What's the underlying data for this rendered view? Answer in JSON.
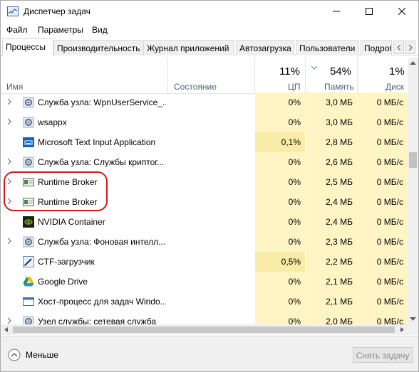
{
  "window": {
    "title": "Диспетчер задач"
  },
  "menu": [
    "Файл",
    "Параметры",
    "Вид"
  ],
  "tabs": [
    "Процессы",
    "Производительность",
    "Журнал приложений",
    "Автозагрузка",
    "Пользователи",
    "Подроб"
  ],
  "header": {
    "name": "Имя",
    "status": "Состояние",
    "cpu_pct": "11%",
    "cpu_label": "ЦП",
    "mem_pct": "54%",
    "mem_label": "Память",
    "disk_pct": "1%",
    "disk_label": "Диск"
  },
  "processes": [
    {
      "name": "Служба узла: WpnUserService_...",
      "cpu": "0%",
      "mem": "3,0 МБ",
      "disk": "0 МБ/с",
      "icon": "gear-icon",
      "expandable": true
    },
    {
      "name": "wsappx",
      "cpu": "0%",
      "mem": "3,0 МБ",
      "disk": "0 МБ/с",
      "icon": "gear-icon",
      "expandable": true
    },
    {
      "name": "Microsoft Text Input Application",
      "cpu": "0,1%",
      "mem": "2,8 МБ",
      "disk": "0 МБ/с",
      "icon": "keyboard-icon",
      "expandable": false
    },
    {
      "name": "Служба узла: Службы криптог...",
      "cpu": "0%",
      "mem": "2,6 МБ",
      "disk": "0 МБ/с",
      "icon": "gear-icon",
      "expandable": true
    },
    {
      "name": "Runtime Broker",
      "cpu": "0%",
      "mem": "2,5 МБ",
      "disk": "0 МБ/с",
      "icon": "window-icon",
      "expandable": true
    },
    {
      "name": "Runtime Broker",
      "cpu": "0%",
      "mem": "2,4 МБ",
      "disk": "0 МБ/с",
      "icon": "window-icon",
      "expandable": true
    },
    {
      "name": "NVIDIA Container",
      "cpu": "0%",
      "mem": "2,4 МБ",
      "disk": "0 МБ/с",
      "icon": "nvidia-icon",
      "expandable": false
    },
    {
      "name": "Служба узла: Фоновая интелл...",
      "cpu": "0%",
      "mem": "2,3 МБ",
      "disk": "0 МБ/с",
      "icon": "gear-icon",
      "expandable": true
    },
    {
      "name": "CTF-загрузчик",
      "cpu": "0,5%",
      "mem": "2,2 МБ",
      "disk": "0 МБ/с",
      "icon": "pen-icon",
      "expandable": false
    },
    {
      "name": "Google Drive",
      "cpu": "0%",
      "mem": "2,1 МБ",
      "disk": "0 МБ/с",
      "icon": "google-drive-icon",
      "expandable": false
    },
    {
      "name": "Хост-процесс для задач Windo...",
      "cpu": "0%",
      "mem": "2,1 МБ",
      "disk": "0 МБ/с",
      "icon": "window-icon",
      "expandable": false
    },
    {
      "name": "Узел службы: сетевая служба",
      "cpu": "0%",
      "mem": "2,0 МБ",
      "disk": "0 МБ/с",
      "icon": "gear-icon",
      "expandable": true
    }
  ],
  "footer": {
    "less": "Меньше",
    "end_task": "Снять задачу"
  },
  "colors": {
    "heat_low": "#fff4c4",
    "heat_mid": "#f9eca8",
    "highlight": "#d11a1a",
    "accent": "#2f6db5"
  }
}
